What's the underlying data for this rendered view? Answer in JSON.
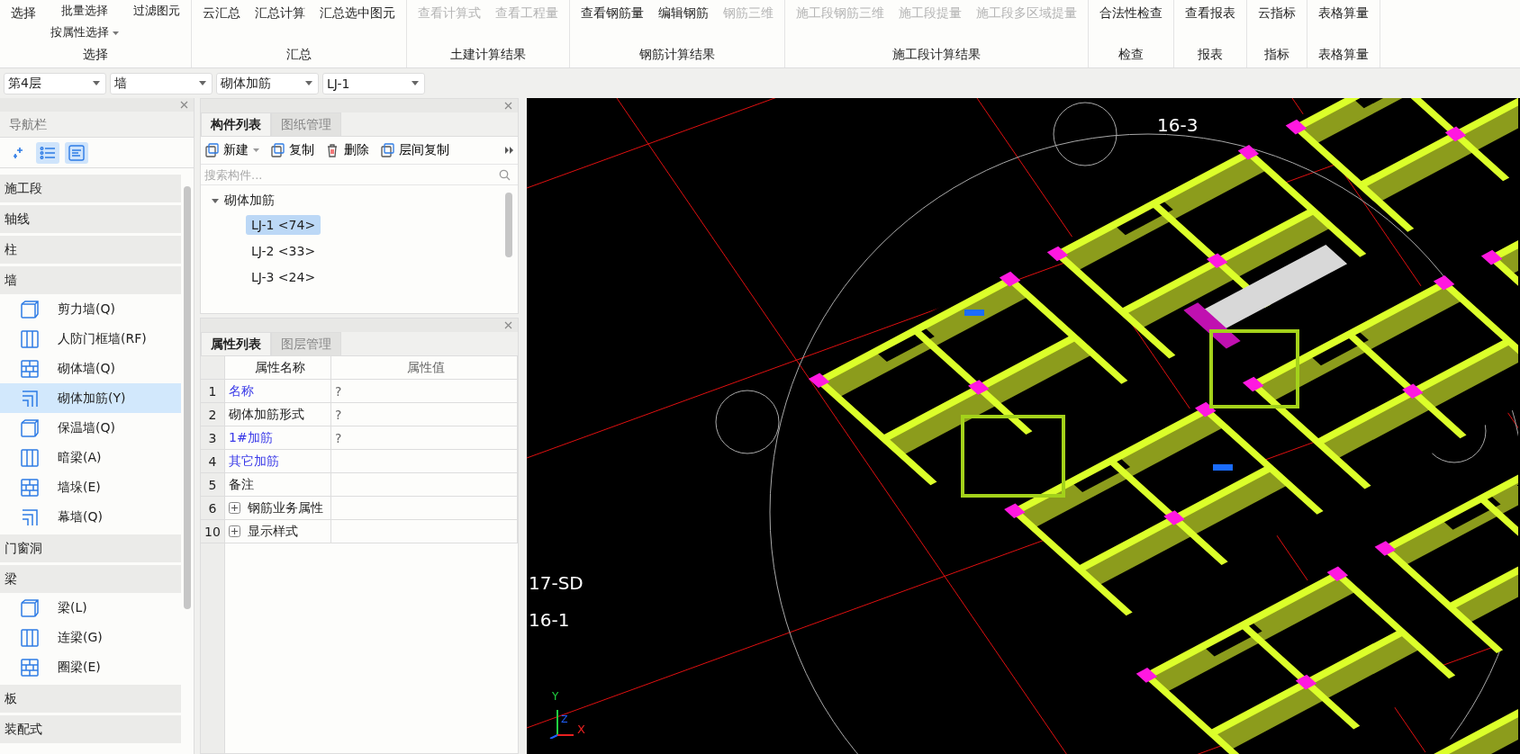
{
  "ribbon": {
    "groups": [
      {
        "label": "选择",
        "items": [
          {
            "label": "选择",
            "kind": "large",
            "disabled": false
          },
          {
            "label": "批量选择",
            "kind": "small",
            "disabled": false
          },
          {
            "label": "按属性选择",
            "kind": "small",
            "disabled": false,
            "dropdown": true
          },
          {
            "label": "过滤图元",
            "kind": "small",
            "disabled": false
          }
        ]
      },
      {
        "label": "汇总",
        "items": [
          {
            "label": "云汇总",
            "kind": "large",
            "disabled": false
          },
          {
            "label": "汇总计算",
            "kind": "large",
            "disabled": false
          },
          {
            "label": "汇总选中图元",
            "kind": "large",
            "disabled": false
          }
        ]
      },
      {
        "label": "土建计算结果",
        "items": [
          {
            "label": "查看计算式",
            "kind": "large",
            "disabled": true
          },
          {
            "label": "查看工程量",
            "kind": "large",
            "disabled": true
          }
        ]
      },
      {
        "label": "钢筋计算结果",
        "items": [
          {
            "label": "查看钢筋量",
            "kind": "large",
            "disabled": false
          },
          {
            "label": "编辑钢筋",
            "kind": "large",
            "disabled": false
          },
          {
            "label": "钢筋三维",
            "kind": "large",
            "disabled": true
          }
        ]
      },
      {
        "label": "施工段计算结果",
        "items": [
          {
            "label": "施工段钢筋三维",
            "kind": "large",
            "disabled": true
          },
          {
            "label": "施工段提量",
            "kind": "large",
            "disabled": true
          },
          {
            "label": "施工段多区域提量",
            "kind": "large",
            "disabled": true
          }
        ]
      },
      {
        "label": "检查",
        "items": [
          {
            "label": "合法性检查",
            "kind": "large",
            "disabled": false
          }
        ]
      },
      {
        "label": "报表",
        "items": [
          {
            "label": "查看报表",
            "kind": "large",
            "disabled": false
          }
        ]
      },
      {
        "label": "指标",
        "items": [
          {
            "label": "云指标",
            "kind": "large",
            "disabled": false
          }
        ]
      },
      {
        "label": "表格算量",
        "items": [
          {
            "label": "表格算量",
            "kind": "large",
            "disabled": false
          }
        ]
      }
    ]
  },
  "selectors": [
    {
      "value": "第4层"
    },
    {
      "value": "墙"
    },
    {
      "value": "砌体加筋"
    },
    {
      "value": "LJ-1"
    }
  ],
  "nav": {
    "title": "导航栏",
    "tools": [
      {
        "selected": false
      },
      {
        "selected": true
      },
      {
        "selected": true
      }
    ],
    "sections": [
      {
        "label": "施工段"
      },
      {
        "label": "轴线"
      },
      {
        "label": "柱"
      },
      {
        "label": "墙",
        "children": [
          {
            "label": "剪力墙(Q)",
            "selected": false
          },
          {
            "label": "人防门框墙(RF)",
            "selected": false
          },
          {
            "label": "砌体墙(Q)",
            "selected": false
          },
          {
            "label": "砌体加筋(Y)",
            "selected": true
          },
          {
            "label": "保温墙(Q)",
            "selected": false
          },
          {
            "label": "暗梁(A)",
            "selected": false
          },
          {
            "label": "墙垛(E)",
            "selected": false
          },
          {
            "label": "幕墙(Q)",
            "selected": false
          }
        ]
      },
      {
        "label": "门窗洞"
      },
      {
        "label": "梁",
        "children": [
          {
            "label": "梁(L)",
            "selected": false
          },
          {
            "label": "连梁(G)",
            "selected": false
          },
          {
            "label": "圈梁(E)",
            "selected": false
          }
        ]
      },
      {
        "label": "板"
      },
      {
        "label": "装配式"
      }
    ]
  },
  "components": {
    "tabs": [
      {
        "label": "构件列表",
        "selected": true
      },
      {
        "label": "图纸管理",
        "selected": false
      }
    ],
    "toolbar": [
      {
        "label": "新建",
        "dropdown": true
      },
      {
        "label": "复制",
        "dropdown": false
      },
      {
        "label": "删除",
        "dropdown": false
      },
      {
        "label": "层间复制",
        "dropdown": false
      }
    ],
    "search": {
      "placeholder": "搜索构件..."
    },
    "tree": [
      {
        "label": "砌体加筋",
        "expanded": true,
        "children": [
          {
            "label": "LJ-1 <74>",
            "selected": true
          },
          {
            "label": "LJ-2 <33>",
            "selected": false
          },
          {
            "label": "LJ-3 <24>",
            "selected": false
          }
        ]
      }
    ]
  },
  "properties": {
    "tabs": [
      {
        "label": "属性列表",
        "selected": true
      },
      {
        "label": "图层管理",
        "selected": false
      }
    ],
    "columns": [
      "属性名称",
      "属性值"
    ],
    "rows": [
      {
        "num": "1",
        "name": "名称",
        "value": "?",
        "public": true,
        "kind": "field"
      },
      {
        "num": "2",
        "name": "砌体加筋形式",
        "value": "?",
        "public": false,
        "kind": "field"
      },
      {
        "num": "3",
        "name": "1#加筋",
        "value": "?",
        "public": true,
        "kind": "field"
      },
      {
        "num": "4",
        "name": "其它加筋",
        "public": true,
        "kind": "field"
      },
      {
        "num": "5",
        "name": "备注",
        "public": false,
        "kind": "field"
      },
      {
        "num": "6",
        "name": "钢筋业务属性",
        "public": false,
        "kind": "group",
        "expanded": false
      },
      {
        "num": "10",
        "name": "显示样式",
        "public": false,
        "kind": "group",
        "expanded": false
      }
    ]
  },
  "viewport": {
    "grid_labels": [
      "16-3",
      "17-SD",
      "16-1"
    ],
    "axis_labels": [
      "X",
      "Y",
      "Z"
    ]
  }
}
